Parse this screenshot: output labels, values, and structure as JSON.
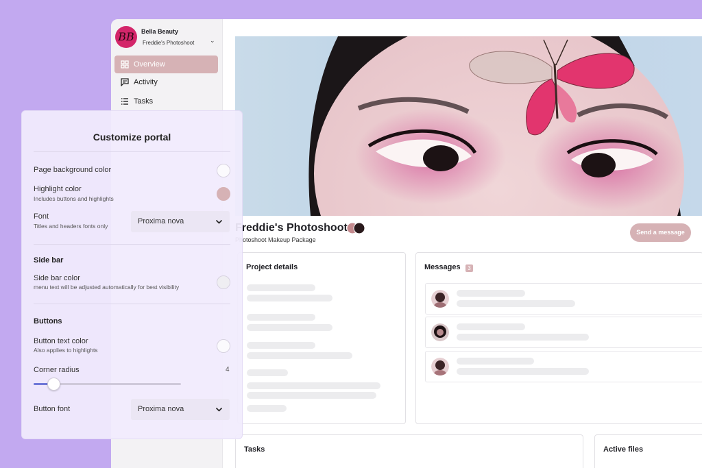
{
  "brand": {
    "logo_text": "BB",
    "name": "Bella Beauty",
    "project": "Freddie's Photoshoot",
    "logo_color": "#d3266a"
  },
  "sidebar": {
    "items": [
      {
        "label": "Overview",
        "icon": "grid-icon",
        "active": true
      },
      {
        "label": "Activity",
        "icon": "chat-icon",
        "active": false
      },
      {
        "label": "Tasks",
        "icon": "list-icon",
        "active": false
      }
    ]
  },
  "project": {
    "title": "Freddie's Photoshoot",
    "subtitle": "Photoshoot Makeup Package",
    "send_button": "Send a message"
  },
  "cards": {
    "project_details": "Project details",
    "messages": {
      "title": "Messages",
      "count": "3"
    },
    "tasks": "Tasks",
    "active_files": "Active files"
  },
  "customize": {
    "title": "Customize portal",
    "page_bg": {
      "label": "Page background color",
      "color": "#fbfafd"
    },
    "highlight": {
      "label": "Highlight color",
      "hint": "Includes buttons and highlights",
      "color": "#d6b2b5"
    },
    "font": {
      "label": "Font",
      "hint": "Titles and headers fonts only",
      "value": "Proxima nova"
    },
    "sidebar_section": "Side bar",
    "sidebar_color": {
      "label": "Side bar color",
      "hint": "menu text will be adjusted automatically for best visibility",
      "color": "#f1f0f3"
    },
    "buttons_section": "Buttons",
    "button_text_color": {
      "label": "Button text color",
      "hint": "Also applies to highlights",
      "color": "#fbfafd"
    },
    "corner_radius": {
      "label": "Corner radius",
      "value": "4",
      "fraction": 0.13
    },
    "button_font": {
      "label": "Button font",
      "value": "Proxima nova"
    }
  },
  "colors": {
    "background": "#c2a9f0",
    "accent": "#d6b2b5",
    "slider": "#6f78d8"
  }
}
